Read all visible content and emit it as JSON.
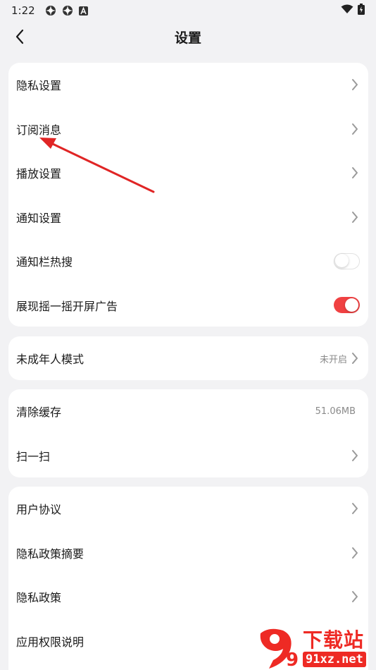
{
  "status_bar": {
    "time": "1:22",
    "left_icons": [
      "gear-notification-icon",
      "gear-notification-icon",
      "font-a-icon"
    ],
    "right_icons": [
      "wifi-icon",
      "battery-icon"
    ]
  },
  "header": {
    "title": "设置"
  },
  "groups": {
    "main": [
      {
        "label": "隐私设置",
        "control": "chevron"
      },
      {
        "label": "订阅消息",
        "control": "chevron"
      },
      {
        "label": "播放设置",
        "control": "chevron"
      },
      {
        "label": "通知设置",
        "control": "chevron"
      },
      {
        "label": "通知栏热搜",
        "control": "toggle",
        "on": false
      },
      {
        "label": "展现摇一摇开屏广告",
        "control": "toggle",
        "on": true
      }
    ],
    "youth": {
      "label": "未成年人模式",
      "value": "未开启"
    },
    "storage": [
      {
        "label": "清除缓存",
        "value": "51.06MB"
      },
      {
        "label": "扫一扫"
      }
    ],
    "legal": [
      {
        "label": "用户协议"
      },
      {
        "label": "隐私政策摘要"
      },
      {
        "label": "隐私政策"
      },
      {
        "label": "应用权限说明"
      }
    ]
  },
  "colors": {
    "accent": "#f04142",
    "annotation_arrow": "#e02525",
    "background": "#f2f2f4"
  },
  "watermark": {
    "logo_text": "9",
    "brand_cn": "下载站",
    "brand_url": "91xz.net"
  }
}
